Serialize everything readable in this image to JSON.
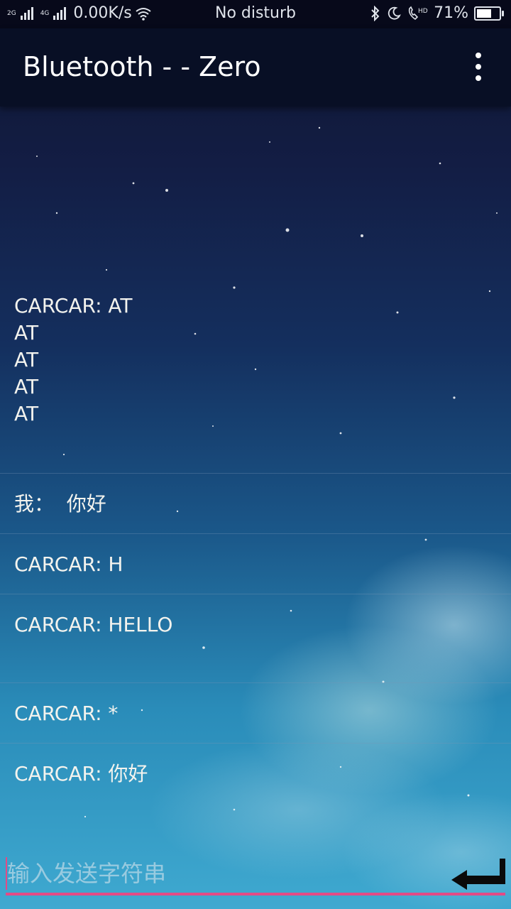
{
  "status_bar": {
    "net_2g": "2G",
    "net_4g": "4G",
    "speed": "0.00K/s",
    "mode": "No disturb",
    "battery_percent": "71%",
    "battery_level": 0.71,
    "icons": [
      "signal-icon",
      "wifi-icon",
      "bluetooth-icon",
      "moon-icon",
      "hd-call-icon",
      "battery-icon"
    ]
  },
  "toolbar": {
    "title": "Bluetooth - - Zero",
    "menu_icon": "overflow-menu-icon"
  },
  "messages": [
    {
      "lines": [
        "CARCAR: AT",
        "AT",
        "AT",
        "AT",
        "AT"
      ]
    },
    {
      "lines": [
        "我：  你好"
      ]
    },
    {
      "lines": [
        "CARCAR: H"
      ]
    },
    {
      "lines": [
        "CARCAR: HELLO",
        ""
      ]
    },
    {
      "lines": [
        "CARCAR: *"
      ]
    },
    {
      "lines": [
        "CARCAR: 你好"
      ]
    }
  ],
  "input": {
    "placeholder": "输入发送字符串",
    "value": "",
    "send_icon": "enter-return-icon"
  },
  "colors": {
    "accent": "#e24b86",
    "toolbar_bg": "#080f25"
  }
}
